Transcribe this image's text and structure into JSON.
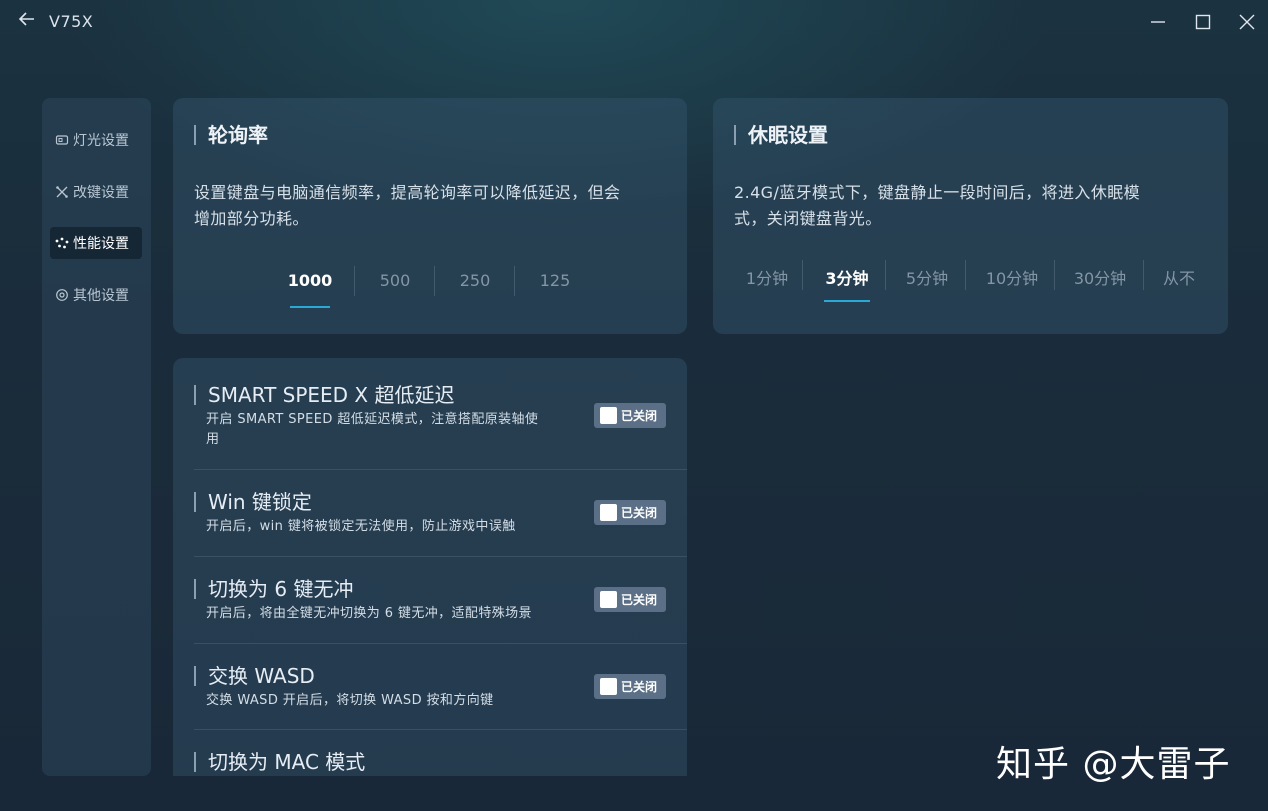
{
  "app": {
    "title": "V75X"
  },
  "sidebar": {
    "items": [
      {
        "label": "灯光设置",
        "icon": "lighting-icon"
      },
      {
        "label": "改键设置",
        "icon": "remap-icon"
      },
      {
        "label": "性能设置",
        "icon": "performance-icon",
        "active": true
      },
      {
        "label": "其他设置",
        "icon": "settings-icon"
      }
    ]
  },
  "polling": {
    "title": "轮询率",
    "desc_line1": "设置键盘与电脑通信频率，提高轮询率可以降低延迟，但会",
    "desc_line2": "增加部分功耗。",
    "options": [
      "1000",
      "500",
      "250",
      "125"
    ],
    "selected": "1000"
  },
  "sleep": {
    "title": "休眠设置",
    "desc_line1": "2.4G/蓝牙模式下，键盘静止一段时间后，将进入休眠模",
    "desc_line2": "式，关闭键盘背光。",
    "options": [
      "1分钟",
      "3分钟",
      "5分钟",
      "10分钟",
      "30分钟",
      "从不"
    ],
    "selected": "3分钟"
  },
  "toggles": [
    {
      "title": "SMART SPEED X 超低延迟",
      "desc_line1": "开启 SMART SPEED 超低延迟模式，注意搭配原装轴使",
      "desc_line2": "用",
      "state": "已关闭"
    },
    {
      "title": "Win 键锁定",
      "desc_line1": "开启后，win 键将被锁定无法使用，防止游戏中误触",
      "state": "已关闭"
    },
    {
      "title": "切换为 6 键无冲",
      "desc_line1": "开启后，将由全键无冲切换为 6 键无冲，适配特殊场景",
      "state": "已关闭"
    },
    {
      "title": "交换 WASD",
      "desc_line1": "交换 WASD 开启后，将切换 WASD 按和方向键",
      "state": "已关闭"
    },
    {
      "title": "切换为 MAC 模式"
    }
  ],
  "watermark": "知乎 @大雷子",
  "colors": {
    "accent": "#2aa9d6",
    "toggle_off": "#5b7086"
  }
}
